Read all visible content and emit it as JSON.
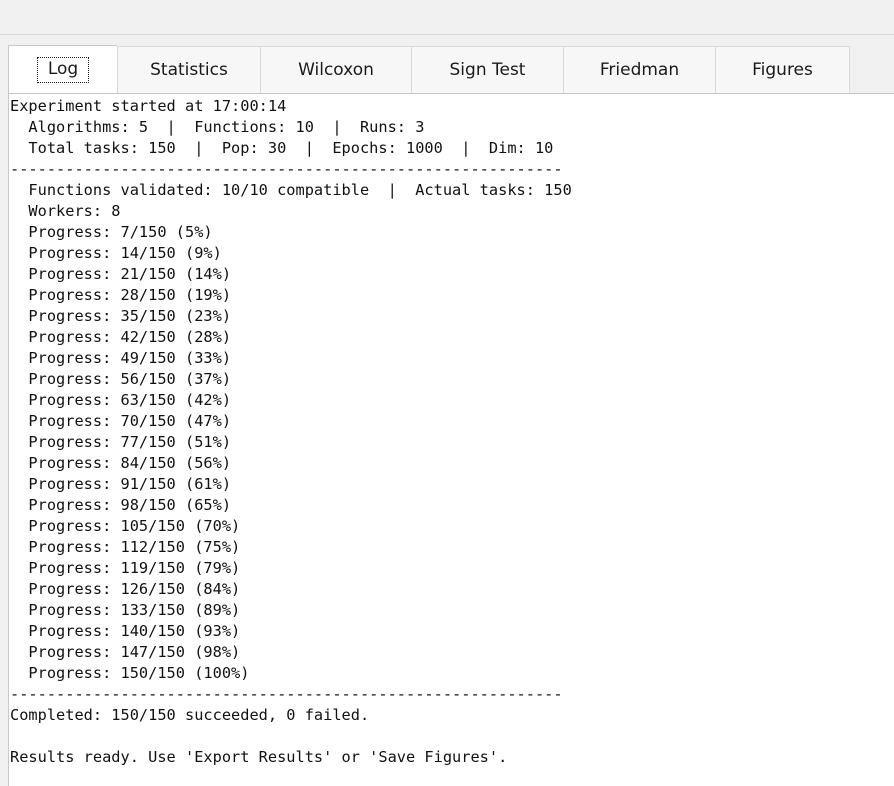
{
  "tabs": [
    {
      "id": "log",
      "label": "Log",
      "active": true
    },
    {
      "id": "statistics",
      "label": "Statistics",
      "active": false
    },
    {
      "id": "wilcoxon",
      "label": "Wilcoxon",
      "active": false
    },
    {
      "id": "sign-test",
      "label": "Sign Test",
      "active": false
    },
    {
      "id": "friedman",
      "label": "Friedman",
      "active": false
    },
    {
      "id": "figures",
      "label": "Figures",
      "active": false
    }
  ],
  "log": {
    "lines": [
      "Experiment started at 17:00:14",
      "  Algorithms: 5  |  Functions: 10  |  Runs: 3",
      "  Total tasks: 150  |  Pop: 30  |  Epochs: 1000  |  Dim: 10",
      "------------------------------------------------------------",
      "  Functions validated: 10/10 compatible  |  Actual tasks: 150",
      "  Workers: 8",
      "  Progress: 7/150 (5%)",
      "  Progress: 14/150 (9%)",
      "  Progress: 21/150 (14%)",
      "  Progress: 28/150 (19%)",
      "  Progress: 35/150 (23%)",
      "  Progress: 42/150 (28%)",
      "  Progress: 49/150 (33%)",
      "  Progress: 56/150 (37%)",
      "  Progress: 63/150 (42%)",
      "  Progress: 70/150 (47%)",
      "  Progress: 77/150 (51%)",
      "  Progress: 84/150 (56%)",
      "  Progress: 91/150 (61%)",
      "  Progress: 98/150 (65%)",
      "  Progress: 105/150 (70%)",
      "  Progress: 112/150 (75%)",
      "  Progress: 119/150 (79%)",
      "  Progress: 126/150 (84%)",
      "  Progress: 133/150 (89%)",
      "  Progress: 140/150 (93%)",
      "  Progress: 147/150 (98%)",
      "  Progress: 150/150 (100%)",
      "------------------------------------------------------------",
      "Completed: 150/150 succeeded, 0 failed.",
      "",
      "Results ready. Use 'Export Results' or 'Save Figures'."
    ]
  }
}
